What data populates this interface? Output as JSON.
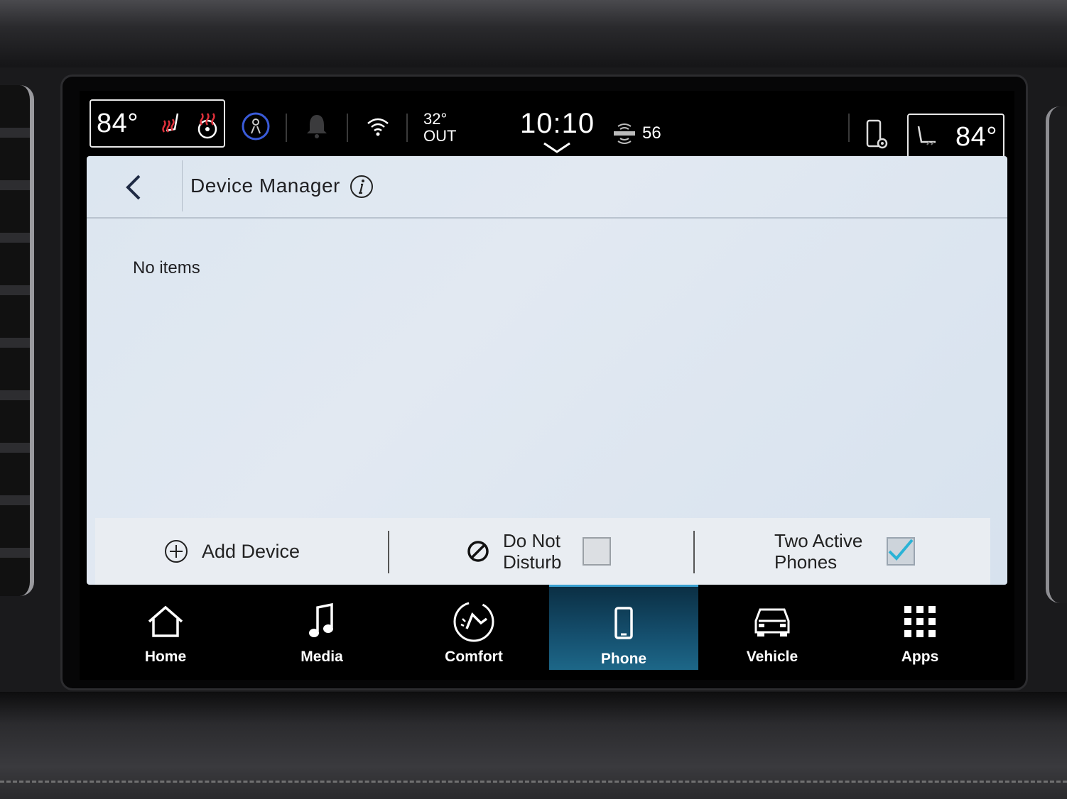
{
  "status_bar": {
    "driver_temp": "84°",
    "passenger_temp": "84°",
    "outside_temp": "32°",
    "outside_label": "OUT",
    "clock": "10:10",
    "siriusxm_label": "SiriusXM",
    "siriusxm_channel": "56",
    "icons": [
      "seat-heat-icon",
      "steering-wheel-heat-icon",
      "driver-assist-icon",
      "notification-bell-icon",
      "wifi-icon",
      "phone-settings-icon",
      "passenger-seat-icon"
    ]
  },
  "header": {
    "title": "Device Manager"
  },
  "main": {
    "empty_text": "No items"
  },
  "actions": {
    "add_device_label": "Add Device",
    "do_not_disturb_line1": "Do Not",
    "do_not_disturb_line2": "Disturb",
    "do_not_disturb_checked": false,
    "two_active_line1": "Two Active",
    "two_active_line2": "Phones",
    "two_active_checked": true
  },
  "nav": {
    "items": [
      {
        "label": "Home",
        "icon": "home-icon"
      },
      {
        "label": "Media",
        "icon": "music-note-icon"
      },
      {
        "label": "Comfort",
        "icon": "comfort-icon"
      },
      {
        "label": "Phone",
        "icon": "phone-icon",
        "active": true
      },
      {
        "label": "Vehicle",
        "icon": "car-icon"
      },
      {
        "label": "Apps",
        "icon": "apps-grid-icon"
      }
    ]
  },
  "colors": {
    "active_tab": "#15506f",
    "heat_red": "#e0303a",
    "check_teal": "#2ab3d6",
    "panel_bg": "#dce6f0",
    "assist_blue": "#3a5bd9"
  }
}
